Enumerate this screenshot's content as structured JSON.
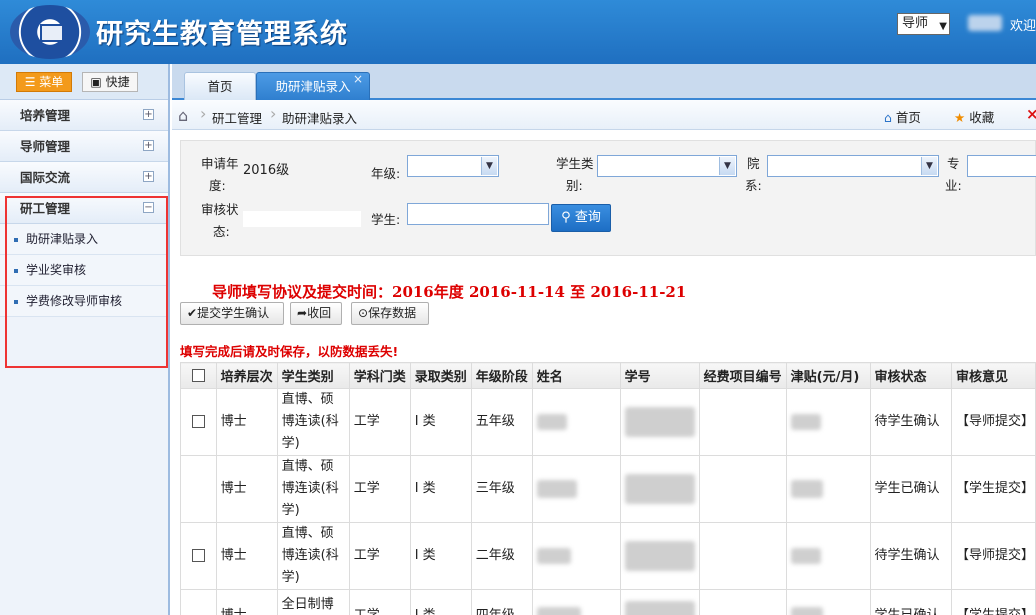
{
  "header": {
    "title": "研究生教育管理系统",
    "role_select": "导师",
    "welcome": "欢迎"
  },
  "left": {
    "menu_label": "菜单",
    "quick_label": "快捷",
    "groups": [
      {
        "label": "培养管理"
      },
      {
        "label": "导师管理"
      },
      {
        "label": "国际交流"
      },
      {
        "label": "研工管理"
      }
    ],
    "sub_items": [
      {
        "label": "助研津贴录入"
      },
      {
        "label": "学业奖审核"
      },
      {
        "label": "学费修改导师审核"
      }
    ]
  },
  "tabs": [
    {
      "label": "首页"
    },
    {
      "label": "助研津贴录入"
    }
  ],
  "breadcrumb": {
    "level1": "研工管理",
    "level2": "助研津贴录入",
    "home_link": "首页",
    "fav_link": "收藏"
  },
  "filter": {
    "year_label_1": "申请年",
    "year_label_2": "度:",
    "year_value": "2016级",
    "grade_label": "年级:",
    "student_type_label_1": "学生类",
    "student_type_label_2": "别:",
    "dept_label_1": "院",
    "dept_label_2": "系:",
    "major_label_1": "专",
    "major_label_2": "业:",
    "status_label_1": "审核状",
    "status_label_2": "态:",
    "student_label": "学生:",
    "search_button": "查询"
  },
  "notice": "导师填写协议及提交时间：2016年度  2016-11-14  至  2016-11-21",
  "toolbar": {
    "submit": "提交学生确认",
    "revoke": "收回",
    "save": "保存数据"
  },
  "warning": "填写完成后请及时保存，以防数据丢失!",
  "table": {
    "headers": [
      "",
      "培养层次",
      "学生类别",
      "学科门类",
      "录取类别",
      "年级阶段",
      "姓名",
      "学号",
      "经费项目编号",
      "津贴(元/月)",
      "审核状态",
      "审核意见"
    ],
    "rows": [
      {
        "level": "博士",
        "type": "直博、硕博连读(科学)",
        "discipline": "工学",
        "admit": "I 类",
        "stage": "五年级",
        "status": "待学生确认",
        "opinion": "【导师提交】",
        "checkbox": true
      },
      {
        "level": "博士",
        "type": "直博、硕博连读(科学)",
        "discipline": "工学",
        "admit": "I 类",
        "stage": "三年级",
        "status": "学生已确认",
        "opinion": "【学生提交】",
        "checkbox": false
      },
      {
        "level": "博士",
        "type": "直博、硕博连读(科学)",
        "discipline": "工学",
        "admit": "I 类",
        "stage": "二年级",
        "status": "待学生确认",
        "opinion": "【导师提交】",
        "checkbox": true
      },
      {
        "level": "博士",
        "type": "全日制博士(科学)",
        "discipline": "工学",
        "admit": "I 类",
        "stage": "四年级",
        "status": "学生已确认",
        "opinion": "【学生提交】",
        "checkbox": false
      }
    ]
  }
}
